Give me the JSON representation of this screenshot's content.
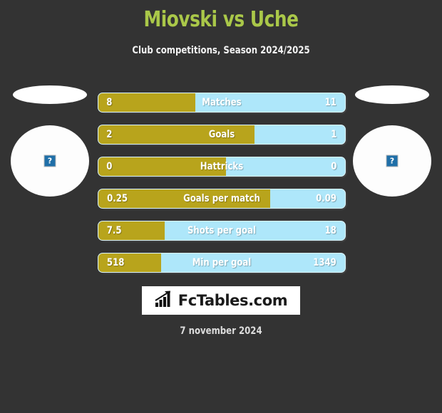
{
  "header": {
    "title": "Miovski vs Uche",
    "subtitle": "Club competitions, Season 2024/2025",
    "title_color": "#aac849"
  },
  "players": {
    "left": {
      "placeholder_icon": "broken-image-icon",
      "placeholder_glyph": "?"
    },
    "right": {
      "placeholder_icon": "broken-image-icon",
      "placeholder_glyph": "?"
    }
  },
  "colors": {
    "background": "#333333",
    "left_bar": "#b8a41c",
    "right_bar": "#aee7fa",
    "text": "#ffffff"
  },
  "chart_data": {
    "type": "bar",
    "title": "Miovski vs Uche",
    "subtitle": "Club competitions, Season 2024/2025",
    "orientation": "horizontal-diverging",
    "categories": [
      "Matches",
      "Goals",
      "Hattricks",
      "Goals per match",
      "Shots per goal",
      "Min per goal"
    ],
    "series": [
      {
        "name": "Miovski",
        "side": "left",
        "color": "#b8a41c",
        "values": [
          "8",
          "2",
          "0",
          "0.25",
          "7.5",
          "518"
        ]
      },
      {
        "name": "Uche",
        "side": "right",
        "color": "#aee7fa",
        "values": [
          "11",
          "1",
          "0",
          "0.09",
          "18",
          "1349"
        ]
      }
    ],
    "fill_percents": [
      39.3,
      63.4,
      51.7,
      69.7,
      26.8,
      25.4
    ],
    "grid": false,
    "legend": "none"
  },
  "rows": [
    {
      "label": "Matches",
      "left": "8",
      "right": "11",
      "fill": 39.3
    },
    {
      "label": "Goals",
      "left": "2",
      "right": "1",
      "fill": 63.4
    },
    {
      "label": "Hattricks",
      "left": "0",
      "right": "0",
      "fill": 51.7
    },
    {
      "label": "Goals per match",
      "left": "0.25",
      "right": "0.09",
      "fill": 69.7
    },
    {
      "label": "Shots per goal",
      "left": "7.5",
      "right": "18",
      "fill": 26.8
    },
    {
      "label": "Min per goal",
      "left": "518",
      "right": "1349",
      "fill": 25.4
    }
  ],
  "watermark": {
    "text": "FcTables.com",
    "icon": "bar-chart-arrow-icon"
  },
  "footer": {
    "date": "7 november 2024"
  }
}
